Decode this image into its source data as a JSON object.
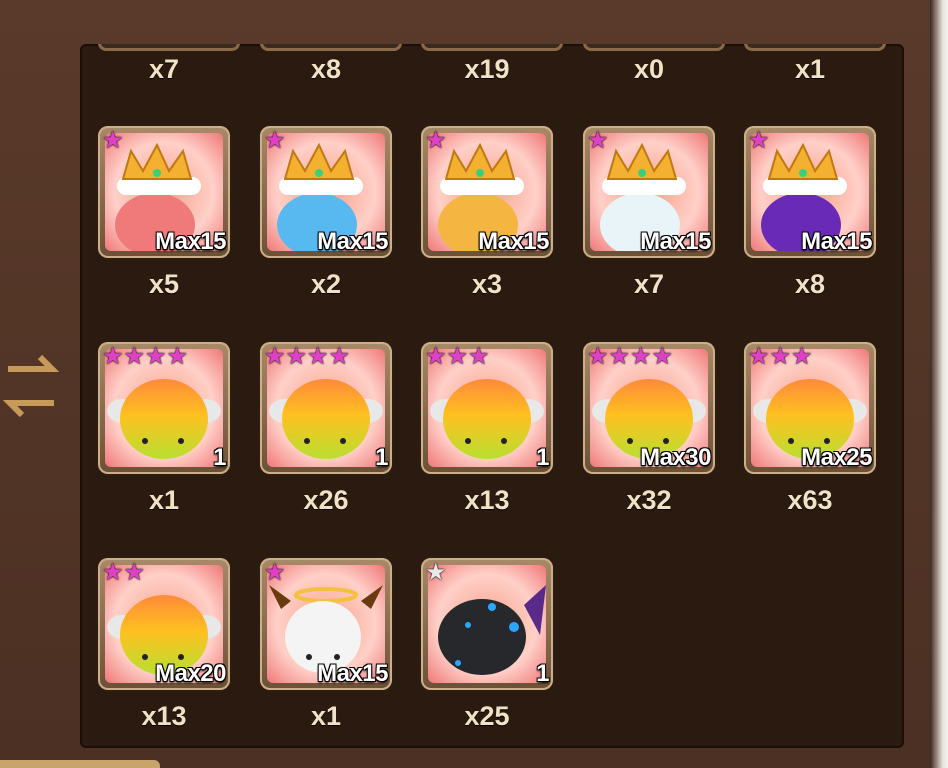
{
  "top_row_counts": [
    "x7",
    "x8",
    "x19",
    "x0",
    "x1"
  ],
  "rows": [
    {
      "items": [
        {
          "icon": "pink-rainbowmon-king-icon",
          "stars": 1,
          "star_color": "pink",
          "label": "Max15",
          "count": "x5",
          "theme": "pink"
        },
        {
          "icon": "blue-rainbowmon-king-icon",
          "stars": 1,
          "star_color": "pink",
          "label": "Max15",
          "count": "x2",
          "theme": "blue"
        },
        {
          "icon": "yellow-rainbowmon-king-icon",
          "stars": 1,
          "star_color": "pink",
          "label": "Max15",
          "count": "x3",
          "theme": "yellow"
        },
        {
          "icon": "white-rainbowmon-king-icon",
          "stars": 1,
          "star_color": "pink",
          "label": "Max15",
          "count": "x7",
          "theme": "white"
        },
        {
          "icon": "purple-rainbowmon-king-icon",
          "stars": 1,
          "star_color": "pink",
          "label": "Max15",
          "count": "x8",
          "theme": "purple"
        }
      ]
    },
    {
      "items": [
        {
          "icon": "angelmon-icon",
          "stars": 4,
          "star_color": "pink",
          "label": "1",
          "count": "x1",
          "theme": "angel"
        },
        {
          "icon": "angelmon-icon",
          "stars": 4,
          "star_color": "pink",
          "label": "1",
          "count": "x26",
          "theme": "angel"
        },
        {
          "icon": "angelmon-icon",
          "stars": 3,
          "star_color": "pink",
          "label": "1",
          "count": "x13",
          "theme": "angel"
        },
        {
          "icon": "angelmon-icon",
          "stars": 4,
          "star_color": "pink",
          "label": "Max30",
          "count": "x32",
          "theme": "angel"
        },
        {
          "icon": "angelmon-icon",
          "stars": 3,
          "star_color": "pink",
          "label": "Max25",
          "count": "x63",
          "theme": "angel"
        }
      ]
    },
    {
      "items": [
        {
          "icon": "angelmon-icon",
          "stars": 2,
          "star_color": "pink",
          "label": "Max20",
          "count": "x13",
          "theme": "angel"
        },
        {
          "icon": "devilmon-white-icon",
          "stars": 1,
          "star_color": "pink",
          "label": "Max15",
          "count": "x1",
          "theme": "devil"
        },
        {
          "icon": "dark-rainbowmon-icon",
          "stars": 1,
          "star_color": "white",
          "label": "1",
          "count": "x25",
          "theme": "dark"
        }
      ]
    }
  ],
  "colors": {
    "panel": "#2a1a10",
    "frame": "#4a2f22",
    "count_text": "#efe2c6",
    "star_pink": "#e040c8"
  },
  "swap_button_icon": "swap-arrows-icon"
}
